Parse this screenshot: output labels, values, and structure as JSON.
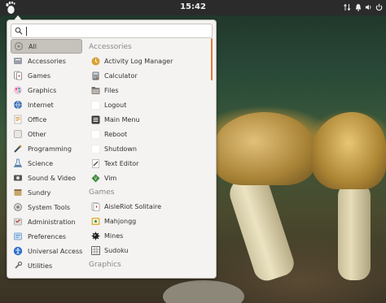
{
  "topbar": {
    "clock": "15:42",
    "tray_icons": [
      "network-icon",
      "bell-icon",
      "volume-icon",
      "power-icon"
    ]
  },
  "search": {
    "value": "",
    "placeholder": ""
  },
  "categories": [
    {
      "label": "All",
      "icon": "all-icon",
      "selected": true,
      "color": "#bcbab4"
    },
    {
      "label": "Accessories",
      "icon": "accessories-icon",
      "color": "#9aa0a8"
    },
    {
      "label": "Games",
      "icon": "games-icon",
      "color": "#c0392b"
    },
    {
      "label": "Graphics",
      "icon": "graphics-icon",
      "color": "#9b59b6"
    },
    {
      "label": "Internet",
      "icon": "internet-icon",
      "color": "#3b6fb6"
    },
    {
      "label": "Office",
      "icon": "office-icon",
      "color": "#d98b2b"
    },
    {
      "label": "Other",
      "icon": "other-icon",
      "color": "#b9b6b0"
    },
    {
      "label": "Programming",
      "icon": "programming-icon",
      "color": "#3f4a55"
    },
    {
      "label": "Science",
      "icon": "science-icon",
      "color": "#5b7fa8"
    },
    {
      "label": "Sound & Video",
      "icon": "sound-video-icon",
      "color": "#7a7a7a"
    },
    {
      "label": "Sundry",
      "icon": "sundry-icon",
      "color": "#8d6e4a"
    },
    {
      "label": "System Tools",
      "icon": "system-tools-icon",
      "color": "#8a8a8a"
    },
    {
      "label": "Administration",
      "icon": "administration-icon",
      "color": "#c0392b"
    },
    {
      "label": "Preferences",
      "icon": "preferences-icon",
      "color": "#5d8fc9"
    },
    {
      "label": "Universal Access",
      "icon": "universal-access-icon",
      "color": "#2e6fcc"
    },
    {
      "label": "Utilities",
      "icon": "utilities-icon",
      "color": "#6b6b6b"
    }
  ],
  "sections": [
    {
      "title": "Accessories",
      "apps": [
        {
          "label": "Activity Log Manager",
          "icon": "activity-log-icon",
          "color": "#d9a233"
        },
        {
          "label": "Calculator",
          "icon": "calculator-icon",
          "color": "#6e7274"
        },
        {
          "label": "Files",
          "icon": "files-icon",
          "color": "#8a8680"
        },
        {
          "label": "Logout",
          "icon": "logout-icon",
          "color": "#ffffff"
        },
        {
          "label": "Main Menu",
          "icon": "main-menu-icon",
          "color": "#3a3a3a"
        },
        {
          "label": "Reboot",
          "icon": "reboot-icon",
          "color": "#ffffff"
        },
        {
          "label": "Shutdown",
          "icon": "shutdown-icon",
          "color": "#ffffff"
        },
        {
          "label": "Text Editor",
          "icon": "text-editor-icon",
          "color": "#4a4a4a"
        },
        {
          "label": "Vim",
          "icon": "vim-icon",
          "color": "#6b6b6b"
        }
      ]
    },
    {
      "title": "Games",
      "apps": [
        {
          "label": "AisleRiot Solitaire",
          "icon": "solitaire-icon",
          "color": "#e8e8e8"
        },
        {
          "label": "Mahjongg",
          "icon": "mahjongg-icon",
          "color": "#e0b44a"
        },
        {
          "label": "Mines",
          "icon": "mines-icon",
          "color": "#222222"
        },
        {
          "label": "Sudoku",
          "icon": "sudoku-icon",
          "color": "#4a4a4a"
        }
      ]
    },
    {
      "title": "Graphics",
      "apps": []
    }
  ]
}
